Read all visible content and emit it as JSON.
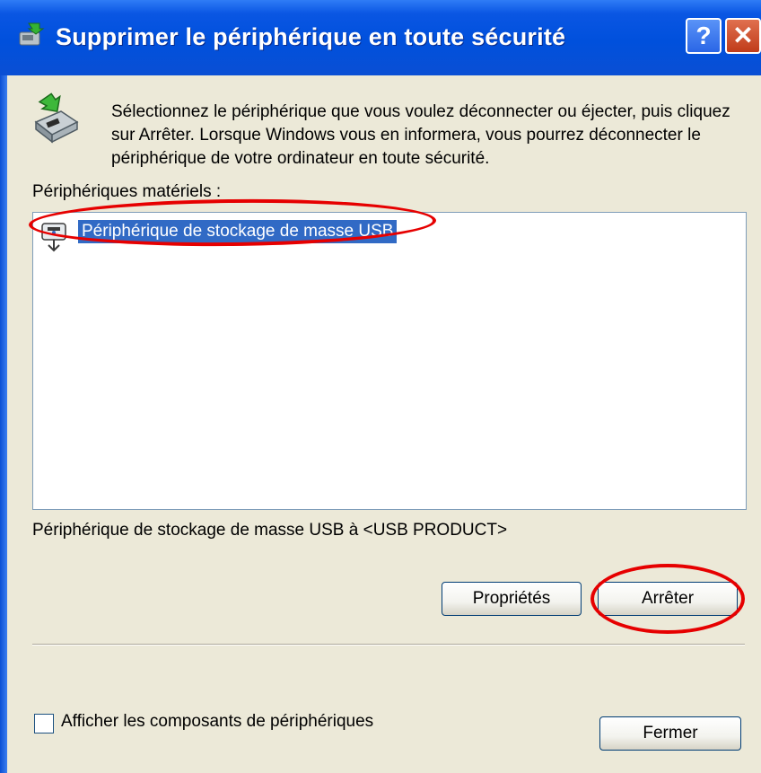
{
  "window": {
    "title": "Supprimer le périphérique en toute sécurité",
    "help_label": "?",
    "close_label": "✕"
  },
  "intro": {
    "text": "Sélectionnez le périphérique que vous voulez déconnecter ou éjecter, puis cliquez sur Arrêter. Lorsque Windows vous en informera, vous pourrez déconnecter le périphérique de votre ordinateur en toute sécurité."
  },
  "devices": {
    "label": "Périphériques matériels :",
    "items": [
      {
        "label": "Périphérique de stockage de masse USB",
        "icon": "usb-device-icon",
        "selected": true
      }
    ]
  },
  "status": {
    "text": "Périphérique de stockage de masse USB à <USB PRODUCT>"
  },
  "buttons": {
    "properties": "Propriétés",
    "stop": "Arrêter",
    "close": "Fermer"
  },
  "options": {
    "show_components_label": "Afficher les composants de périphériques",
    "show_components_checked": false
  },
  "colors": {
    "titlebar": "#0050dc",
    "selection": "#316ac5",
    "annotation": "#e60000",
    "face": "#ece9d8"
  }
}
